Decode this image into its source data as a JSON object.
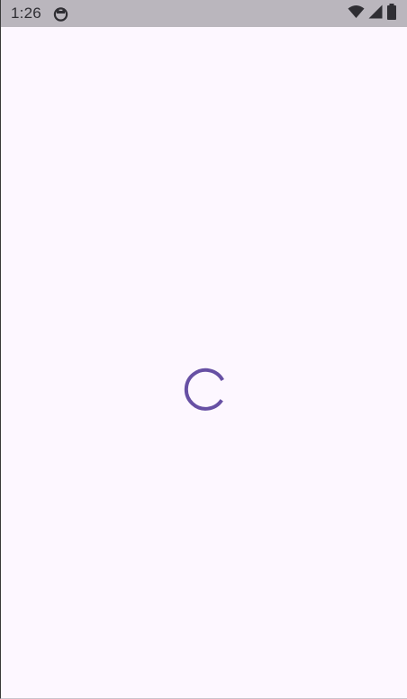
{
  "status_bar": {
    "time": "1:26",
    "icons": {
      "notification": "cat-face-icon",
      "wifi": "wifi-icon",
      "signal": "cellular-signal-icon",
      "battery": "battery-icon"
    }
  },
  "main": {
    "state": "loading",
    "spinner_icon": "circular-progress-spinner"
  },
  "colors": {
    "status_bar_bg": "#bab6bd",
    "background": "#fdf7ff",
    "spinner": "#6750a4",
    "status_icons": "#2f2e33"
  }
}
